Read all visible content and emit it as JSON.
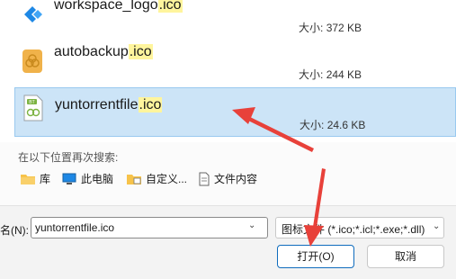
{
  "results": [
    {
      "name": "workspace_logo",
      "ext": ".ico",
      "size_label": "大小:",
      "size": "372 KB",
      "icon": "workspace-logo-icon",
      "selected": false
    },
    {
      "name": "autobackup",
      "ext": ".ico",
      "size_label": "大小:",
      "size": "244 KB",
      "icon": "autobackup-icon",
      "selected": false
    },
    {
      "name": "yuntorrentfile",
      "ext": ".ico",
      "size_label": "大小:",
      "size": "24.6 KB",
      "icon": "torrent-file-icon",
      "selected": true
    }
  ],
  "search_again": {
    "title": "在以下位置再次搜索:",
    "locations": [
      {
        "label": "库",
        "icon": "library-folder-icon"
      },
      {
        "label": "此电脑",
        "icon": "this-pc-icon"
      },
      {
        "label": "自定义...",
        "icon": "custom-folder-icon"
      },
      {
        "label": "文件内容",
        "icon": "file-content-icon"
      }
    ]
  },
  "filename": {
    "label": "名(N):",
    "value": "yuntorrentfile.ico"
  },
  "filter": {
    "selected": "图标文件 (*.ico;*.icl;*.exe;*.dll)"
  },
  "buttons": {
    "open": "打开(O)",
    "cancel": "取消"
  },
  "colors": {
    "selection": "#cce4f7",
    "highlight": "#fff59d",
    "annotation_arrow": "#e8413a"
  }
}
